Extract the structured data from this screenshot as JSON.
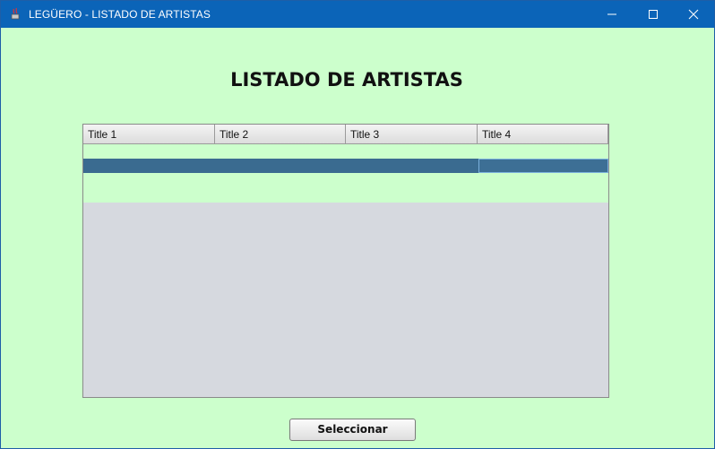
{
  "window": {
    "title": "LEGÜERO - LISTADO DE ARTISTAS"
  },
  "heading": "LISTADO DE ARTISTAS",
  "table": {
    "columns": [
      "Title 1",
      "Title 2",
      "Title 3",
      "Title 4"
    ],
    "row_count": 4,
    "selected_row": 2,
    "focused_column": 4,
    "colors": {
      "rows_bg": "#ccffcc",
      "selection_bg": "#3a6b90",
      "empty_area": "#d6d9df"
    }
  },
  "select_button_label": "Seleccionar",
  "colors": {
    "window_bg": "#ccffcc",
    "titlebar": "#0b64b8"
  }
}
